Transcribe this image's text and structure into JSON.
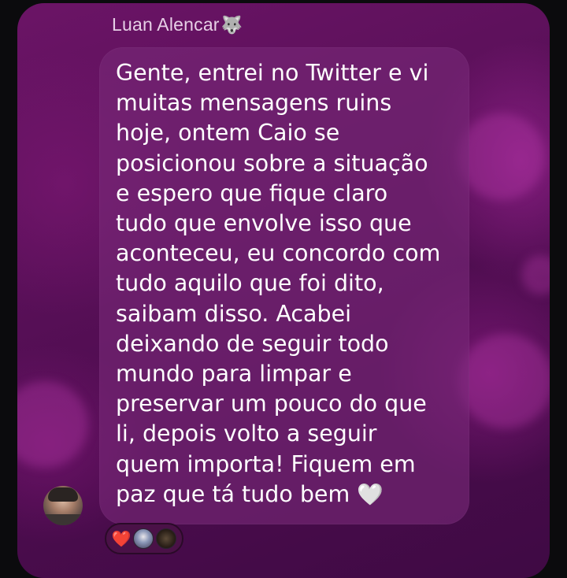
{
  "message": {
    "sender_name": "Luan Alencar",
    "sender_emoji": "🐺",
    "text": "Gente, entrei no Twitter e vi\nmuitas mensagens ruins\nhoje, ontem Caio se\nposicionou sobre a situação\ne espero que fique claro\ntudo que envolve isso que\naconteceu, eu concordo com\ntudo aquilo que foi dito,\nsaibam disso. Acabei\ndeixando de seguir todo\nmundo para limpar e\npreservar um pouco do que\nli, depois volto a seguir\nquem importa! Fiquem em\npaz que tá tudo bem",
    "trailing_emoji": "🤍",
    "bubble_color": "#7a2a7a",
    "background_color": "#5a1059"
  },
  "reactions": [
    {
      "type": "emoji",
      "value": "❤️",
      "icon": "red-heart-icon",
      "color": "#e8403f"
    },
    {
      "type": "avatar",
      "icon": "reactor-avatar-1"
    },
    {
      "type": "avatar",
      "icon": "reactor-avatar-2"
    }
  ]
}
